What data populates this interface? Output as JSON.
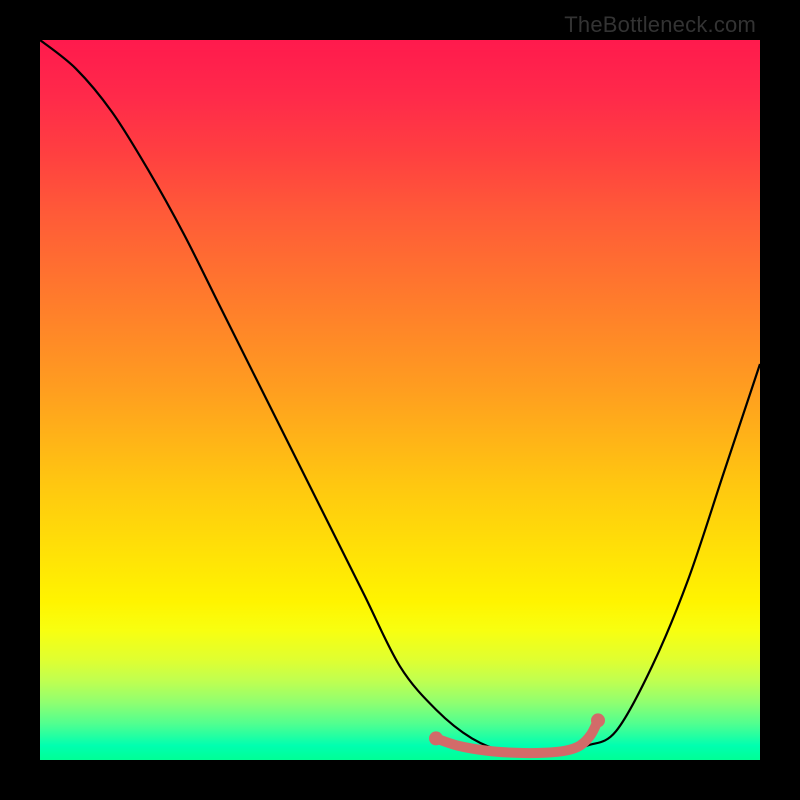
{
  "watermark": "TheBottleneck.com",
  "chart_data": {
    "type": "line",
    "title": "",
    "xlabel": "",
    "ylabel": "",
    "xlim": [
      0,
      100
    ],
    "ylim": [
      0,
      100
    ],
    "grid": false,
    "series": [
      {
        "name": "bottleneck-curve",
        "x": [
          0,
          5,
          10,
          15,
          20,
          25,
          30,
          35,
          40,
          45,
          50,
          55,
          60,
          65,
          68,
          72,
          76,
          80,
          85,
          90,
          95,
          100
        ],
        "values": [
          100,
          96,
          90,
          82,
          73,
          63,
          53,
          43,
          33,
          23,
          13,
          7,
          3,
          1,
          1,
          1,
          2,
          4,
          13,
          25,
          40,
          55
        ]
      }
    ],
    "optimal_segment": {
      "name": "optimal-range",
      "color": "#d26b69",
      "x": [
        55,
        58,
        62,
        66,
        70,
        73,
        75,
        76.5,
        77.5
      ],
      "values": [
        3,
        2,
        1.3,
        1,
        1,
        1.3,
        2,
        3.5,
        5.5
      ]
    },
    "optimal_endpoints": {
      "start": {
        "x": 55,
        "y": 3
      },
      "end": {
        "x": 77.5,
        "y": 5.5
      }
    }
  }
}
